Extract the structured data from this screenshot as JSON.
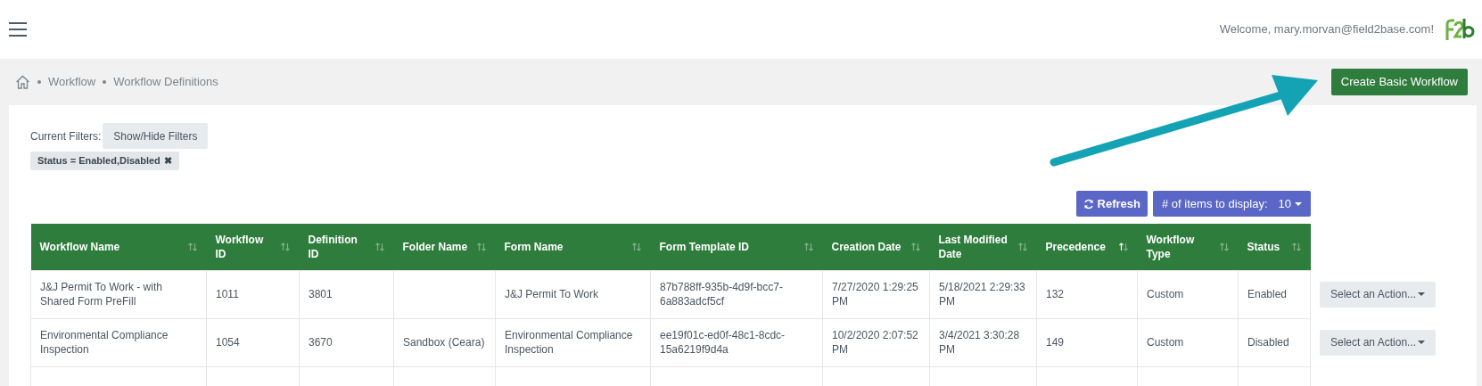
{
  "header": {
    "welcome": "Welcome, mary.morvan@field2base.com!"
  },
  "breadcrumbs": [
    "Workflow",
    "Workflow Definitions"
  ],
  "create_button": "Create Basic Workflow",
  "filters": {
    "label": "Current Filters:",
    "toggle_button": "Show/Hide Filters",
    "tags": [
      "Status = Enabled,Disabled"
    ],
    "remove_mark": "✖"
  },
  "toolbar": {
    "refresh": "Refresh",
    "items_label": "# of items to display:",
    "items_value": "10"
  },
  "table": {
    "columns": [
      {
        "label": "Workflow Name",
        "sorted": false
      },
      {
        "label": "Workflow ID",
        "sorted": false
      },
      {
        "label": "Definition ID",
        "sorted": false
      },
      {
        "label": "Folder Name",
        "sorted": false
      },
      {
        "label": "Form Name",
        "sorted": false
      },
      {
        "label": "Form Template ID",
        "sorted": false
      },
      {
        "label": "Creation Date",
        "sorted": false
      },
      {
        "label": "Last Modified Date",
        "sorted": false
      },
      {
        "label": "Precedence",
        "sorted": true
      },
      {
        "label": "Workflow Type",
        "sorted": false
      },
      {
        "label": "Status",
        "sorted": false
      }
    ],
    "rows": [
      {
        "cells": [
          "J&J Permit To Work - with Shared Form PreFill",
          "1011",
          "3801",
          "",
          "J&J Permit To Work",
          "87b788ff-935b-4d9f-bcc7-6a883adcf5cf",
          "7/27/2020 1:29:25 PM",
          "5/18/2021 2:29:33 PM",
          "132",
          "Custom",
          "Enabled"
        ],
        "action": "Select an Action..."
      },
      {
        "cells": [
          "Environmental Compliance Inspection",
          "1054",
          "3670",
          "Sandbox (Ceara)",
          "Environmental Compliance Inspection",
          "ee19f01c-ed0f-48c1-8cdc-15a6219f9d4a",
          "10/2/2020 2:07:52 PM",
          "3/4/2021 3:30:28 PM",
          "149",
          "Custom",
          "Disabled"
        ],
        "action": "Select an Action..."
      }
    ]
  }
}
